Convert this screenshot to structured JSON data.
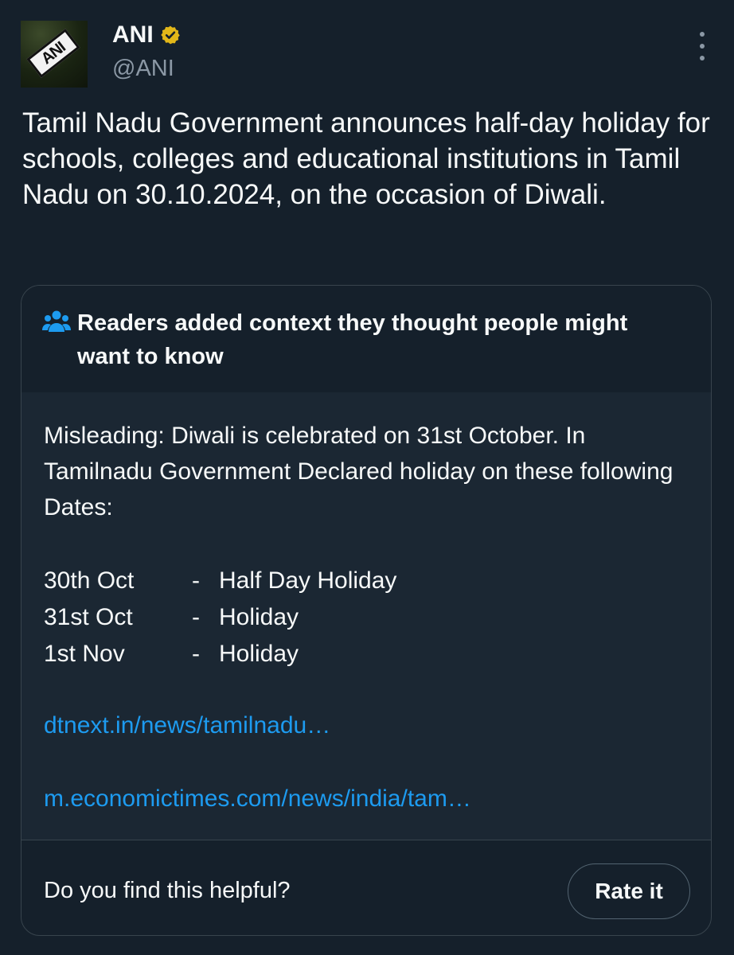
{
  "tweet": {
    "author_name": "ANI",
    "author_handle": "@ANI",
    "avatar_text": "ANI",
    "text": "Tamil Nadu Government announces half-day holiday for schools, colleges and educational institutions in Tamil Nadu on 30.10.2024, on the occasion of Diwali."
  },
  "community_note": {
    "title": "Readers added context they thought people might want to know",
    "intro": "Misleading: Diwali is celebrated on 31st October. In Tamilnadu Government Declared holiday on these following Dates:",
    "dates": [
      {
        "date": "30th Oct",
        "separator": "-",
        "label": "Half Day Holiday"
      },
      {
        "date": "31st Oct",
        "separator": "-",
        "label": "Holiday"
      },
      {
        "date": "1st Nov",
        "separator": "-",
        "label": "Holiday"
      }
    ],
    "links": [
      "dtnext.in/news/tamilnadu…",
      "m.economictimes.com/news/india/tam…"
    ],
    "question": "Do you find this helpful?",
    "rate_button": "Rate it"
  },
  "colors": {
    "background": "#15202b",
    "note_body": "#1b2733",
    "link": "#1d9bf0",
    "verified": "#e2b719",
    "secondary_text": "#8b98a5"
  },
  "icons": {
    "verified": "verified-badge-icon",
    "more": "more-options-icon",
    "people": "people-icon"
  }
}
